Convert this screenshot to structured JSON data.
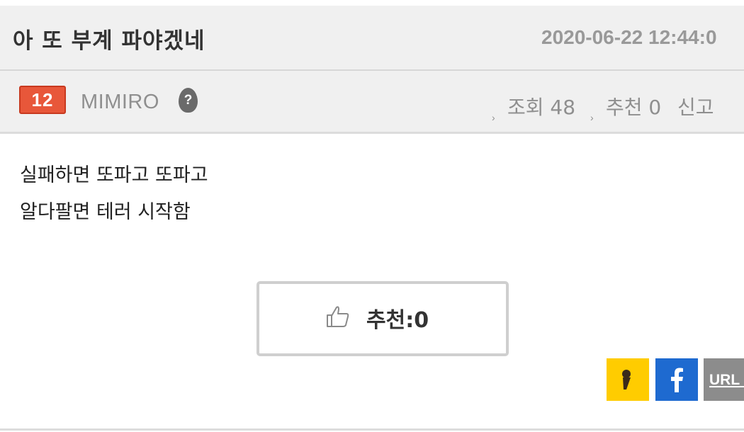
{
  "post": {
    "title": "아 또 부계 파야겠네",
    "date": "2020-06-22 12:44:0"
  },
  "author": {
    "level": "12",
    "level_color": "#e8573a",
    "nickname": "MIMIRO",
    "info_icon": "question-icon"
  },
  "stats": {
    "views_label": "조회 48",
    "recommend_label": "추천 0",
    "report_label": "신고"
  },
  "content": {
    "lines": [
      "실패하면 또파고 또파고",
      "알다팔면 테러 시작함"
    ]
  },
  "recommend_button": {
    "icon": "thumbs-up-icon",
    "label": "추천:0"
  },
  "share": {
    "kakaostory": {
      "icon": "kakaostory-icon",
      "color": "#ffcc00"
    },
    "facebook": {
      "icon": "facebook-icon",
      "color": "#1e6ad0"
    },
    "url": {
      "label": "URL",
      "color": "#8c8c8c"
    }
  }
}
